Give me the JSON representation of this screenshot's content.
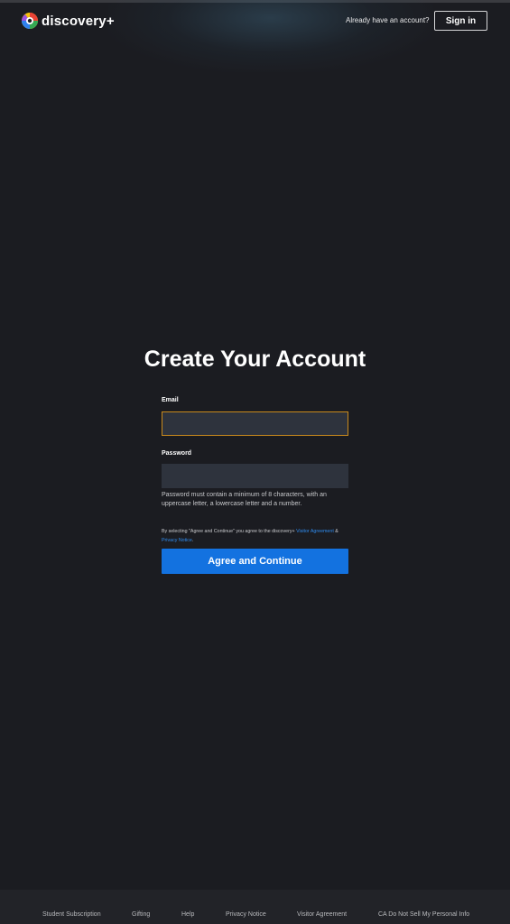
{
  "header": {
    "brand": "discovery+",
    "logo_icon": "discovery-plus-logo-icon",
    "already_text": "Already have an account?",
    "signin_label": "Sign in"
  },
  "form": {
    "title": "Create Your Account",
    "email_label": "Email",
    "email_value": "",
    "password_label": "Password",
    "password_value": "",
    "password_hint": "Password must contain a minimum of 8 characters, with an uppercase letter, a lowercase letter and a number.",
    "consent_prefix": "By selecting \"Agree and Continue\" you agree to the discovery+ ",
    "consent_link1": "Visitor Agreement",
    "consent_middle": " & ",
    "consent_link2": "Privacy Notice",
    "consent_suffix": ".",
    "submit_label": "Agree and Continue"
  },
  "footer": {
    "links": [
      "Student Subscription",
      "Gifting",
      "Help",
      "Privacy Notice",
      "Visitor Agreement",
      "CA Do Not Sell My Personal Info"
    ]
  },
  "colors": {
    "background": "#1b1c21",
    "accent": "#1372e0",
    "focus_border": "#c98a1c",
    "link": "#2f8cf0"
  }
}
